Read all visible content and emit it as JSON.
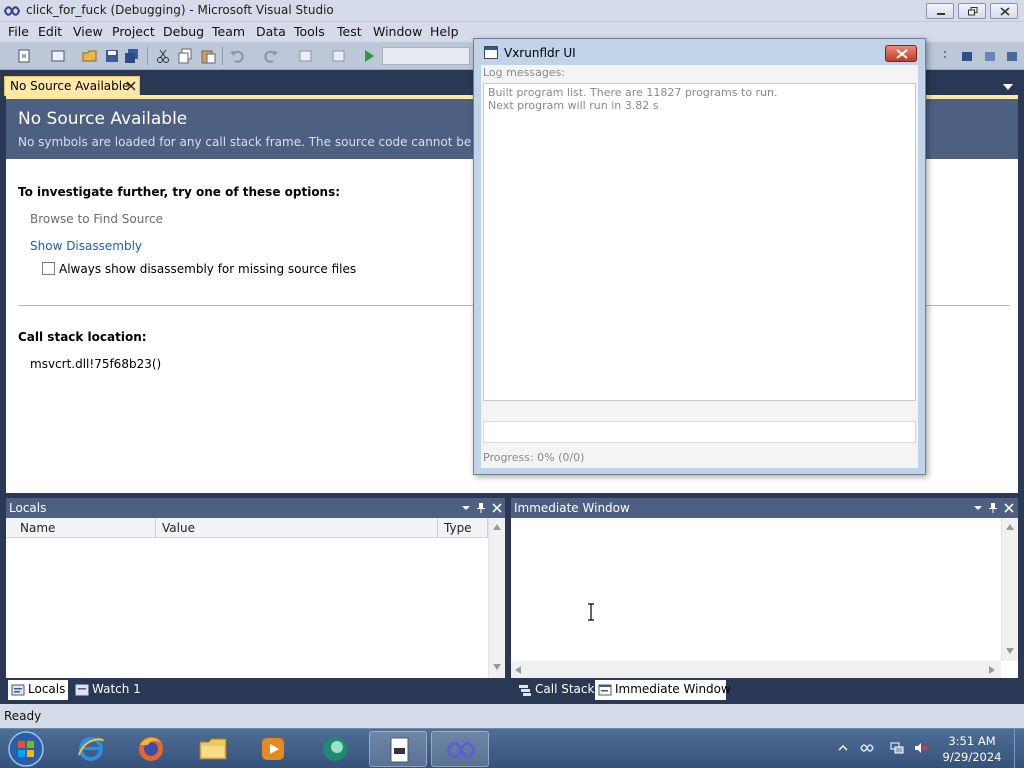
{
  "window": {
    "title": "click_for_fuck (Debugging) - Microsoft Visual Studio"
  },
  "menu": [
    "File",
    "Edit",
    "View",
    "Project",
    "Debug",
    "Team",
    "Data",
    "Tools",
    "Test",
    "Window",
    "Help"
  ],
  "document": {
    "tab_label": "No Source Available",
    "banner_title": "No Source Available",
    "banner_subtitle": "No symbols are loaded for any call stack frame. The source code cannot be displayed.",
    "investigate_heading": "To investigate further, try one of these options:",
    "browse_link": "Browse to Find Source",
    "disassembly_link": "Show Disassembly",
    "always_show_label": "Always show disassembly for missing source files",
    "always_show_checked": false,
    "callstack_heading": "Call stack location:",
    "callstack_frame": "msvcrt.dll!75f68b23()"
  },
  "locals": {
    "title": "Locals",
    "columns": [
      "Name",
      "Value",
      "Type"
    ]
  },
  "immediate": {
    "title": "Immediate Window"
  },
  "bottom_tabs_left": [
    "Locals",
    "Watch 1"
  ],
  "bottom_tabs_right": [
    "Call Stack",
    "Immediate Window"
  ],
  "status": {
    "text": "Ready"
  },
  "dialog": {
    "title": "Vxrunfldr UI",
    "log_label": "Log messages:",
    "log_lines": [
      "Built program list. There are 11827 programs to run.",
      "Next program will run in 3.82 s"
    ],
    "progress_text": "Progress: 0% (0/0)"
  },
  "taskbar": {
    "apps": [
      "windows-explorer-icon",
      "internet-explorer-icon",
      "firefox-icon",
      "file-explorer-icon",
      "media-player-icon",
      "browser-icon",
      "document-icon",
      "visual-studio-icon"
    ],
    "time": "3:51 AM",
    "date": "9/29/2024"
  }
}
